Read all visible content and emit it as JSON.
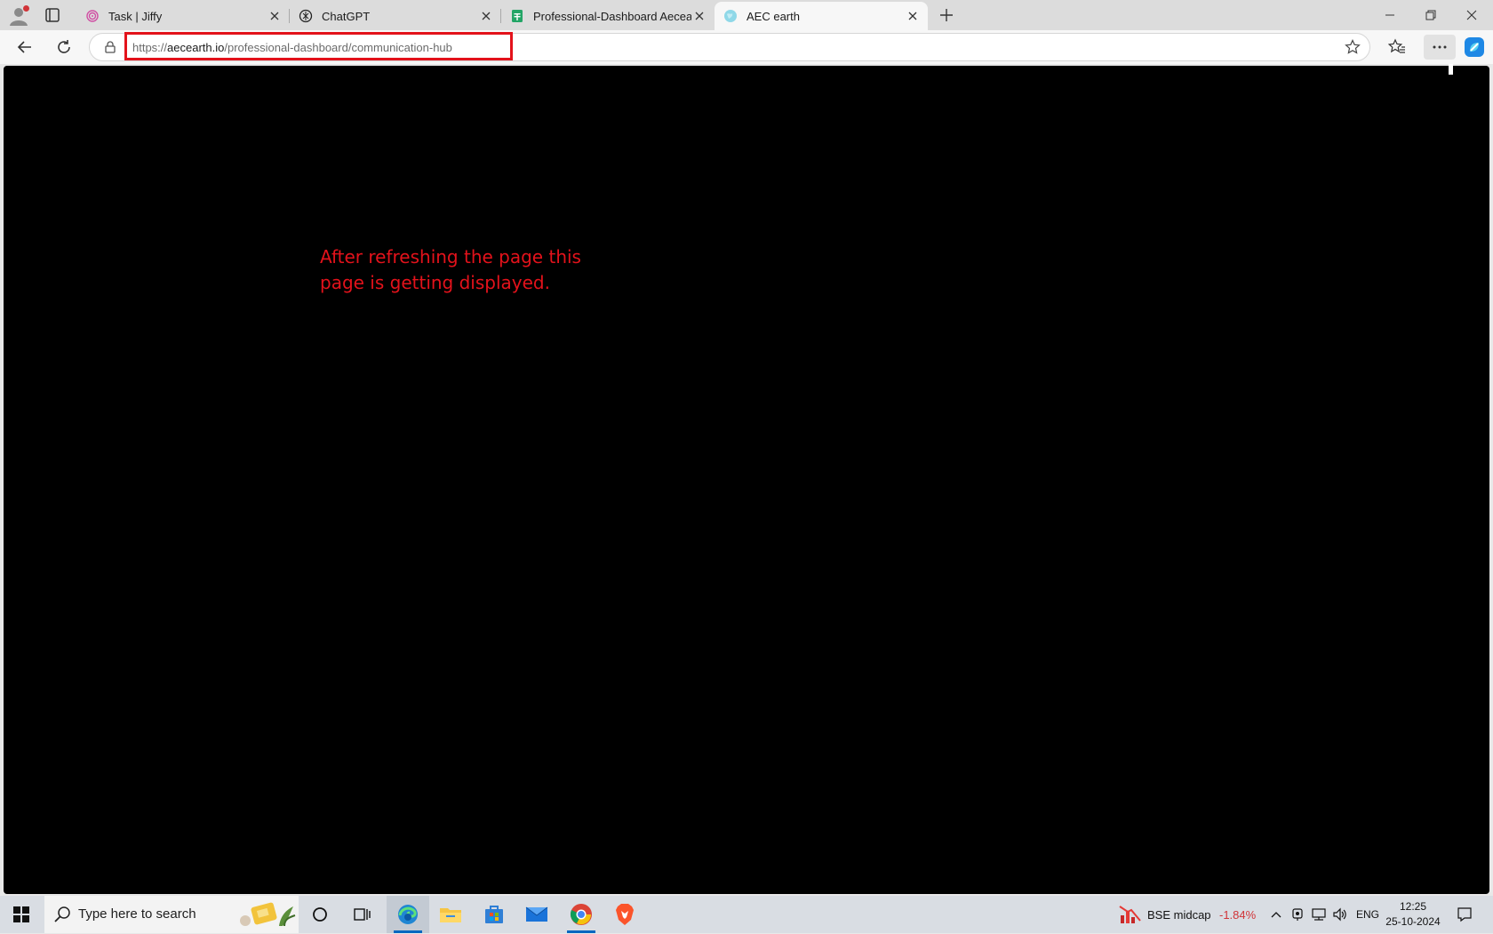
{
  "browser": {
    "tabs": [
      {
        "title": "Task | Jiffy",
        "favicon": "jiffy-fingerprint-icon",
        "active": false
      },
      {
        "title": "ChatGPT",
        "favicon": "chatgpt-icon",
        "active": false
      },
      {
        "title": "Professional-Dashboard Aecearth",
        "favicon": "google-sheets-icon",
        "active": false
      },
      {
        "title": "AEC earth",
        "favicon": "globe-icon",
        "active": true
      }
    ],
    "address_bar": {
      "scheme": "https://",
      "host": "aecearth.io",
      "path": "/professional-dashboard/communication-hub"
    },
    "highlight_color": "#e3121b"
  },
  "page": {
    "background": "#000000",
    "annotation": "After refreshing the page this page is getting displayed."
  },
  "taskbar": {
    "search_placeholder": "Type here to search",
    "apps": [
      "cortana-icon",
      "task-view-icon",
      "edge-icon",
      "file-explorer-icon",
      "microsoft-store-icon",
      "mail-icon",
      "chrome-icon",
      "brave-icon"
    ],
    "stock": {
      "name": "BSE midcap",
      "change": "-1.84%",
      "color": "#d13438"
    },
    "language": "ENG",
    "time": "12:25",
    "date": "25-10-2024"
  }
}
